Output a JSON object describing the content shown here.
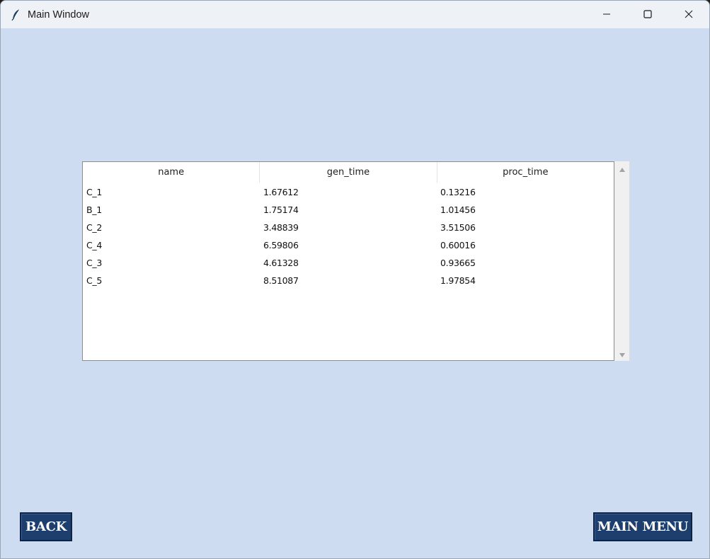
{
  "window": {
    "title": "Main Window"
  },
  "table": {
    "columns": [
      "name",
      "gen_time",
      "proc_time"
    ],
    "rows": [
      [
        "C_1",
        "1.67612",
        "0.13216"
      ],
      [
        "B_1",
        "1.75174",
        "1.01456"
      ],
      [
        "C_2",
        "3.48839",
        "3.51506"
      ],
      [
        "C_4",
        "6.59806",
        "0.60016"
      ],
      [
        "C_3",
        "4.61328",
        "0.93665"
      ],
      [
        "C_5",
        "8.51087",
        "1.97854"
      ]
    ]
  },
  "buttons": {
    "back": "BACK",
    "main_menu": "MAIN MENU"
  },
  "icons": {
    "app": "feather-icon",
    "minimize": "minimize-icon",
    "maximize": "maximize-icon",
    "close": "close-icon"
  },
  "colors": {
    "background": "#cddcf1",
    "button": "#1e3f6e"
  }
}
